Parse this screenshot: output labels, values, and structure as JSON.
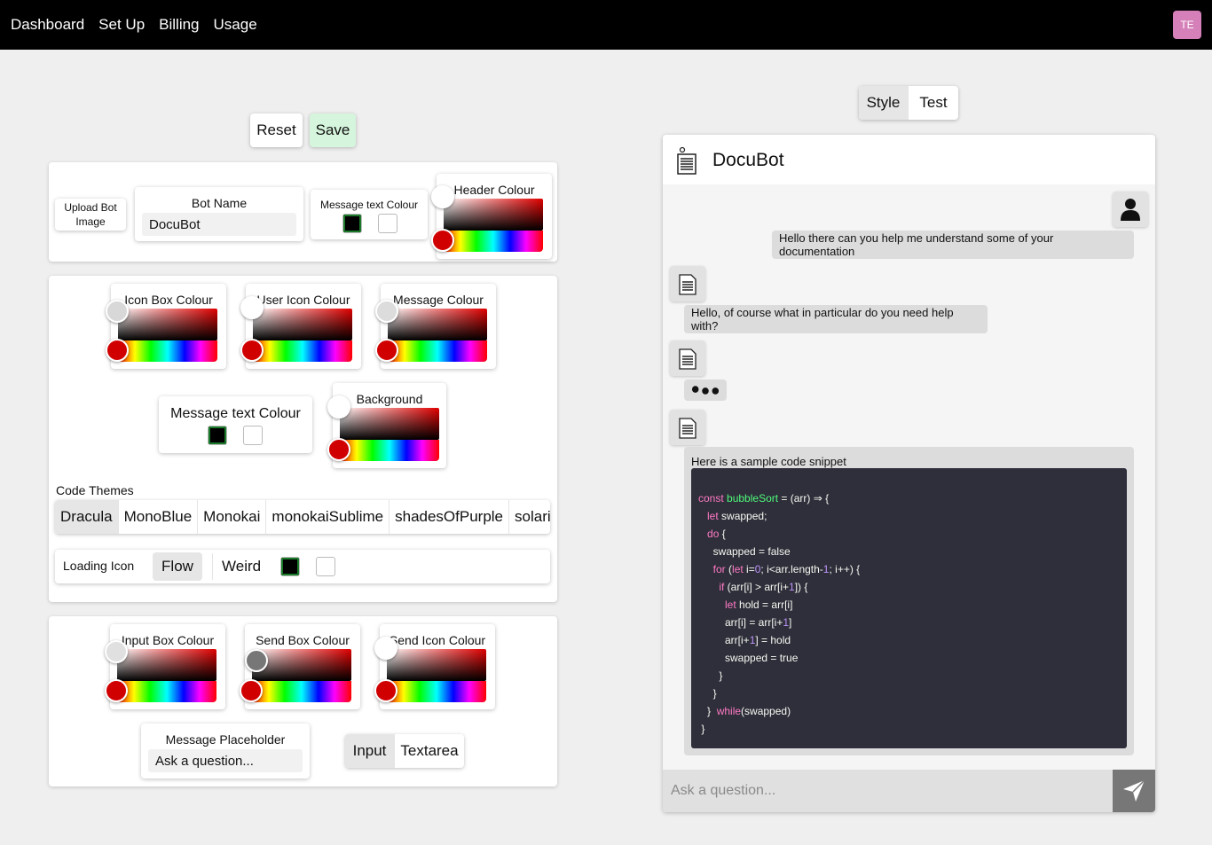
{
  "nav": {
    "items": [
      "Dashboard",
      "Set Up",
      "Billing",
      "Usage"
    ],
    "avatar": "TE"
  },
  "toolbar": {
    "reset": "Reset",
    "save": "Save"
  },
  "preview_tabs": {
    "style": "Style",
    "test": "Test"
  },
  "header_panel": {
    "upload_label": "Upload Bot Image",
    "bot_name_label": "Bot Name",
    "bot_name_value": "DocuBot",
    "msg_text_colour": "Message text Colour",
    "header_colour": "Header Colour"
  },
  "colours_panel": {
    "icon_box": "Icon Box Colour",
    "user_icon": "User Icon Colour",
    "message": "Message Colour",
    "msg_text_colour": "Message text Colour",
    "background": "Background",
    "code_themes_label": "Code Themes",
    "code_themes": [
      "Dracula",
      "MonoBlue",
      "Monokai",
      "monokaiSublime",
      "shadesOfPurple",
      "solarized"
    ],
    "selected_theme": "Dracula",
    "loading_icon_label": "Loading Icon",
    "loading_options": [
      "Flow",
      "Weird"
    ],
    "selected_loading": "Flow"
  },
  "input_panel": {
    "input_box": "Input Box Colour",
    "send_box": "Send Box Colour",
    "send_icon": "Send Icon Colour",
    "placeholder_label": "Message Placeholder",
    "placeholder_value": "Ask a question...",
    "input_types": [
      "Input",
      "Textarea"
    ],
    "selected_input_type": "Input"
  },
  "chat": {
    "bot_name": "DocuBot",
    "user_message": "Hello there can you help me understand some of your documentation",
    "bot_reply": "Hello, of course what in particular do you need help with?",
    "snippet_intro": "Here is a sample code snippet",
    "input_placeholder": "Ask a question..."
  },
  "colors": {
    "nav_bg": "#000000",
    "save_bg": "#d5f5dc",
    "avatar_bg": "#d580b8",
    "code_bg": "#2e2f3a",
    "send_bg": "#777777"
  }
}
